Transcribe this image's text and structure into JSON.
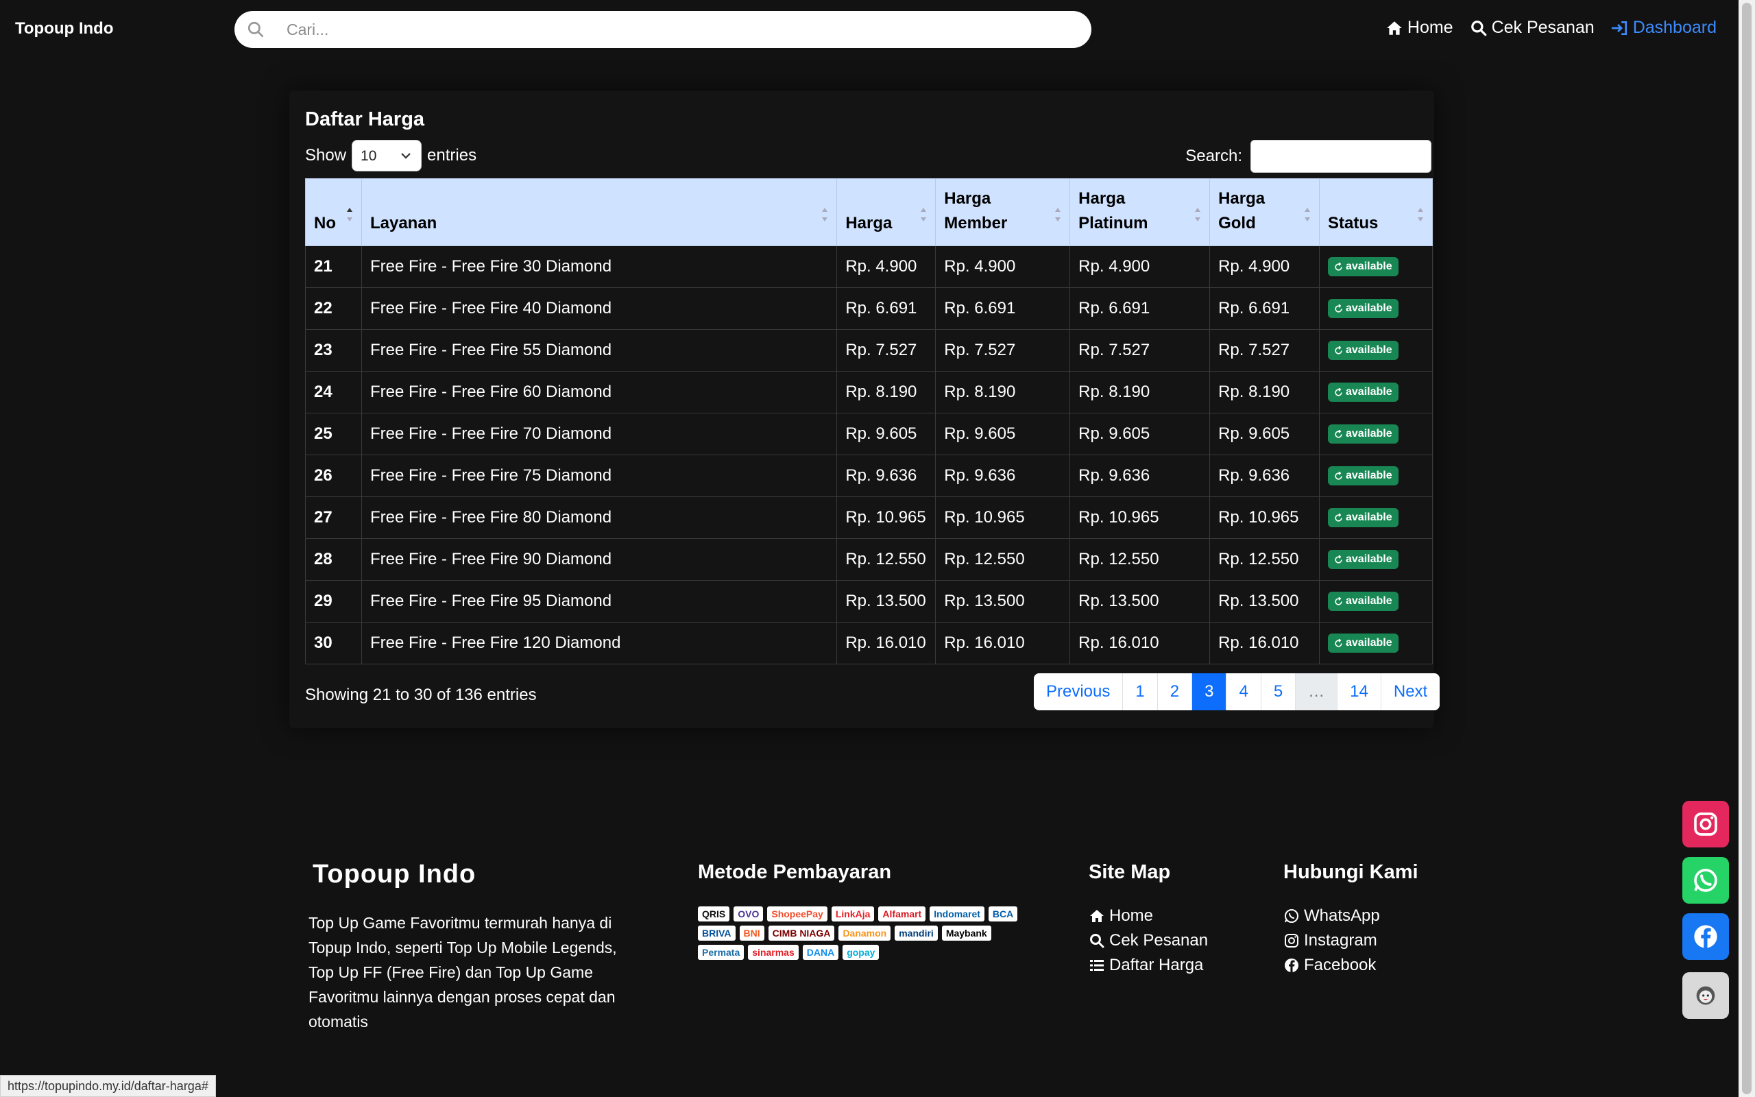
{
  "navbar": {
    "brand": "Topoup Indo",
    "search_placeholder": "Cari...",
    "links": [
      {
        "label": "Home",
        "icon": "home-icon"
      },
      {
        "label": "Cek Pesanan",
        "icon": "search-icon"
      },
      {
        "label": "Dashboard",
        "icon": "sign-in-icon"
      }
    ]
  },
  "main": {
    "title": "Daftar Harga",
    "show_label": "Show",
    "entries_label": "entries",
    "page_length": "10",
    "search_label": "Search:",
    "columns": [
      "No",
      "Layanan",
      "Harga",
      "Harga Member",
      "Harga Platinum",
      "Harga Gold",
      "Status"
    ],
    "rows": [
      {
        "no": "21",
        "layanan": "Free Fire - Free Fire 30 Diamond",
        "harga": "Rp. 4.900",
        "member": "Rp. 4.900",
        "platinum": "Rp. 4.900",
        "gold": "Rp. 4.900",
        "status": "available"
      },
      {
        "no": "22",
        "layanan": "Free Fire - Free Fire 40 Diamond",
        "harga": "Rp. 6.691",
        "member": "Rp. 6.691",
        "platinum": "Rp. 6.691",
        "gold": "Rp. 6.691",
        "status": "available"
      },
      {
        "no": "23",
        "layanan": "Free Fire - Free Fire 55 Diamond",
        "harga": "Rp. 7.527",
        "member": "Rp. 7.527",
        "platinum": "Rp. 7.527",
        "gold": "Rp. 7.527",
        "status": "available"
      },
      {
        "no": "24",
        "layanan": "Free Fire - Free Fire 60 Diamond",
        "harga": "Rp. 8.190",
        "member": "Rp. 8.190",
        "platinum": "Rp. 8.190",
        "gold": "Rp. 8.190",
        "status": "available"
      },
      {
        "no": "25",
        "layanan": "Free Fire - Free Fire 70 Diamond",
        "harga": "Rp. 9.605",
        "member": "Rp. 9.605",
        "platinum": "Rp. 9.605",
        "gold": "Rp. 9.605",
        "status": "available"
      },
      {
        "no": "26",
        "layanan": "Free Fire - Free Fire 75 Diamond",
        "harga": "Rp. 9.636",
        "member": "Rp. 9.636",
        "platinum": "Rp. 9.636",
        "gold": "Rp. 9.636",
        "status": "available"
      },
      {
        "no": "27",
        "layanan": "Free Fire - Free Fire 80 Diamond",
        "harga": "Rp. 10.965",
        "member": "Rp. 10.965",
        "platinum": "Rp. 10.965",
        "gold": "Rp. 10.965",
        "status": "available"
      },
      {
        "no": "28",
        "layanan": "Free Fire - Free Fire 90 Diamond",
        "harga": "Rp. 12.550",
        "member": "Rp. 12.550",
        "platinum": "Rp. 12.550",
        "gold": "Rp. 12.550",
        "status": "available"
      },
      {
        "no": "29",
        "layanan": "Free Fire - Free Fire 95 Diamond",
        "harga": "Rp. 13.500",
        "member": "Rp. 13.500",
        "platinum": "Rp. 13.500",
        "gold": "Rp. 13.500",
        "status": "available"
      },
      {
        "no": "30",
        "layanan": "Free Fire - Free Fire 120 Diamond",
        "harga": "Rp. 16.010",
        "member": "Rp. 16.010",
        "platinum": "Rp. 16.010",
        "gold": "Rp. 16.010",
        "status": "available"
      }
    ],
    "info": "Showing 21 to 30 of 136 entries",
    "pagination": [
      {
        "label": "Previous",
        "state": "normal"
      },
      {
        "label": "1",
        "state": "normal"
      },
      {
        "label": "2",
        "state": "normal"
      },
      {
        "label": "3",
        "state": "active"
      },
      {
        "label": "4",
        "state": "normal"
      },
      {
        "label": "5",
        "state": "normal"
      },
      {
        "label": "…",
        "state": "ellipsis"
      },
      {
        "label": "14",
        "state": "normal"
      },
      {
        "label": "Next",
        "state": "normal"
      }
    ]
  },
  "footer": {
    "brand": "Topoup Indo",
    "description": "Top Up Game Favoritmu termurah hanya di Topup Indo, seperti Top Up Mobile Legends, Top Up FF (Free Fire) dan Top Up Game Favoritmu lainnya dengan proses cepat dan otomatis",
    "payment_title": "Metode Pembayaran",
    "payment_logos": [
      "QRIS",
      "OVO",
      "ShopeePay",
      "LinkAja",
      "Alfamart",
      "Indomaret",
      "BCA",
      "BRIVA",
      "BNI",
      "CIMB NIAGA",
      "Danamon",
      "mandiri",
      "Maybank",
      "Permata",
      "sinarmas",
      "DANA",
      "gopay"
    ],
    "sitemap_title": "Site Map",
    "sitemap": [
      {
        "label": "Home",
        "icon": "home-icon"
      },
      {
        "label": "Cek Pesanan",
        "icon": "search-icon"
      },
      {
        "label": "Daftar Harga",
        "icon": "list-icon"
      }
    ],
    "contact_title": "Hubungi Kami",
    "contact": [
      {
        "label": "WhatsApp",
        "icon": "whatsapp-icon"
      },
      {
        "label": "Instagram",
        "icon": "instagram-icon"
      },
      {
        "label": "Facebook",
        "icon": "facebook-icon"
      }
    ]
  },
  "floating": [
    {
      "name": "instagram-fab",
      "color": "#e4285d"
    },
    {
      "name": "whatsapp-fab",
      "color": "#25d366"
    },
    {
      "name": "facebook-fab",
      "color": "#1877f2"
    },
    {
      "name": "support-fab",
      "color": "#d9d9d9"
    }
  ],
  "status_url": "https://topupindo.my.id/daftar-harga#",
  "colors": {
    "background": "#121212",
    "table_header": "#cfe2ff",
    "badge": "#198754",
    "link_active": "#3d8bfd",
    "pager_active": "#0d6efd"
  }
}
